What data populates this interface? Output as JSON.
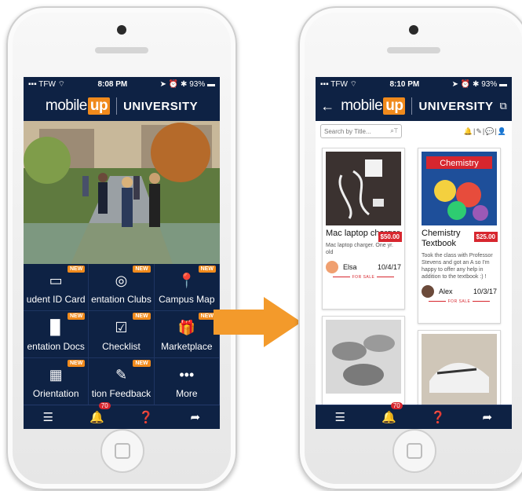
{
  "left_phone": {
    "status": {
      "carrier": "TFW",
      "time": "8:08 PM",
      "battery": "93%"
    },
    "header": {
      "logo_text": "mobile",
      "logo_up": "up",
      "title": "UNIVERSITY"
    },
    "tiles": [
      {
        "label": "udent ID Card",
        "icon": "id-card-icon",
        "glyph": "▭",
        "new": "NEW"
      },
      {
        "label": "entation Clubs",
        "icon": "target-icon",
        "glyph": "◎",
        "new": "NEW"
      },
      {
        "label": "Campus Map",
        "icon": "map-pin-icon",
        "glyph": "📍",
        "new": "NEW"
      },
      {
        "label": "entation Docs",
        "icon": "document-icon",
        "glyph": "▉",
        "new": "NEW"
      },
      {
        "label": "Checklist",
        "icon": "checklist-icon",
        "glyph": "☑",
        "new": "NEW"
      },
      {
        "label": "Marketplace",
        "icon": "gift-icon",
        "glyph": "🎁",
        "new": "NEW"
      },
      {
        "label": "Orientation",
        "icon": "calendar-icon",
        "glyph": "▦",
        "new": "NEW"
      },
      {
        "label": "tion Feedback",
        "icon": "edit-icon",
        "glyph": "✎",
        "new": "NEW"
      },
      {
        "label": "More",
        "icon": "more-icon",
        "glyph": "•••",
        "new": ""
      }
    ],
    "tabbar": {
      "notification_count": "70"
    }
  },
  "right_phone": {
    "status": {
      "carrier": "TFW",
      "time": "8:10 PM",
      "battery": "93%"
    },
    "header": {
      "logo_text": "mobile",
      "logo_up": "up",
      "title": "UNIVERSITY"
    },
    "search": {
      "placeholder": "Search by Title..."
    },
    "listings": [
      {
        "title": "Mac laptop charger",
        "price": "$50.00",
        "description": "Mac laptop charger. One yr. old",
        "seller": "Elsa",
        "date": "10/4/17",
        "tag": "FOR SALE"
      },
      {
        "title": "Chemistry Textbook",
        "price": "$25.00",
        "description": "Took the class with Professor Stevens and got an A so I'm happy to offer any help in addition to the textbook :) !",
        "seller": "Alex",
        "date": "10/3/17",
        "tag": "FOR SALE"
      }
    ],
    "tabbar": {
      "notification_count": "70"
    }
  },
  "colors": {
    "navy": "#0e2244",
    "orange": "#f08a1c",
    "red": "#d7262e"
  }
}
